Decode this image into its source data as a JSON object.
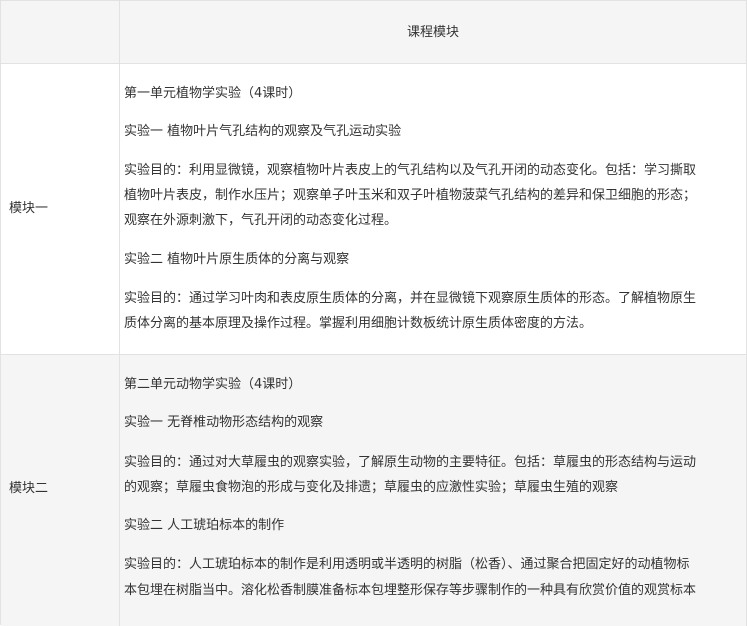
{
  "header": {
    "left": "",
    "right": "课程模块"
  },
  "module1": {
    "label": "模块一",
    "lines": [
      "第一单元植物学实验（4课时）",
      "实验一 植物叶片气孔结构的观察及气孔运动实验",
      "实验目的：利用显微镜，观察植物叶片表皮上的气孔结构以及气孔开闭的动态变化。包括：学习撕取",
      "植物叶片表皮，制作水压片；观察单子叶玉米和双子叶植物菠菜气孔结构的差异和保卫细胞的形态；",
      "观察在外源刺激下，气孔开闭的动态变化过程。",
      "实验二 植物叶片原生质体的分离与观察",
      "实验目的：通过学习叶肉和表皮原生质体的分离，并在显微镜下观察原生质体的形态。了解植物原生",
      "质体分离的基本原理及操作过程。掌握利用细胞计数板统计原生质体密度的方法。"
    ]
  },
  "module2": {
    "label": "模块二",
    "lines": [
      "第二单元动物学实验（4课时）",
      "实验一 无脊椎动物形态结构的观察",
      "实验目的：通过对大草履虫的观察实验，了解原生动物的主要特征。包括：草履虫的形态结构与运动",
      "的观察；草履虫食物泡的形成与变化及排遗；草履虫的应激性实验；草履虫生殖的观察",
      "实验二 人工琥珀标本的制作",
      "实验目的：人工琥珀标本的制作是利用透明或半透明的树脂（松香）、通过聚合把固定好的动植物标",
      "本包埋在树脂当中。溶化松香制膜准备标本包埋整形保存等步骤制作的一种具有欣赏价值的观赏标本"
    ]
  }
}
